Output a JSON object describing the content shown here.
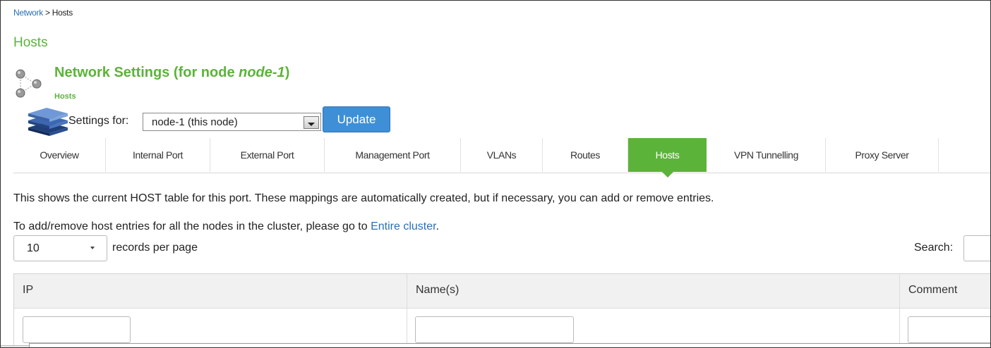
{
  "breadcrumb": {
    "parent": "Network",
    "separator": ">",
    "current": "Hosts"
  },
  "page_title": "Hosts",
  "network_settings": {
    "title_prefix": "Network Settings (for node ",
    "node_name": "node-1",
    "title_suffix": ")",
    "subtitle": "Hosts"
  },
  "settings_for": {
    "label": "Settings for:",
    "selected": "node-1 (this node)",
    "update_label": "Update"
  },
  "tabs": [
    {
      "label": "Overview"
    },
    {
      "label": "Internal Port"
    },
    {
      "label": "External Port"
    },
    {
      "label": "Management Port"
    },
    {
      "label": "VLANs"
    },
    {
      "label": "Routes"
    },
    {
      "label": "Hosts",
      "active": true
    },
    {
      "label": "VPN Tunnelling"
    },
    {
      "label": "Proxy Server"
    }
  ],
  "description": {
    "line1": "This shows the current HOST table for this port. These mappings are automatically created, but if necessary, you can add or remove entries.",
    "line2_prefix": "To add/remove host entries for all the nodes in the cluster, please go to ",
    "line2_link": "Entire cluster",
    "line2_suffix": "."
  },
  "records_per_page": {
    "value": "10",
    "label": "records per page"
  },
  "search": {
    "label": "Search:"
  },
  "table": {
    "columns": [
      "IP",
      "Name(s)",
      "Comment"
    ]
  },
  "colors": {
    "accent_green": "#5cb33a",
    "link_blue": "#2a6fb5",
    "button_blue": "#3e8fd5"
  },
  "icons": {
    "network": "network-nodes-icon",
    "settings": "stacked-servers-icon"
  }
}
